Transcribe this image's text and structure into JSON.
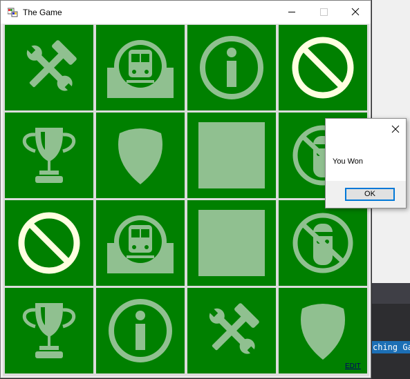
{
  "window": {
    "title": "The Game",
    "buttons": [
      "minimize",
      "maximize",
      "close"
    ]
  },
  "board": {
    "rows": 4,
    "columns": 4,
    "tile_color": "#008000",
    "icon_color": "#90c090",
    "highlight_color": "#ffffe0",
    "tiles": [
      {
        "icon": "tools-icon"
      },
      {
        "icon": "train-icon"
      },
      {
        "icon": "info-icon"
      },
      {
        "icon": "no-entry-icon",
        "highlighted": true
      },
      {
        "icon": "trophy-icon"
      },
      {
        "icon": "shield-icon"
      },
      {
        "icon": "square-icon"
      },
      {
        "icon": "no-smoking-man-icon"
      },
      {
        "icon": "no-entry-icon",
        "highlighted": true
      },
      {
        "icon": "train-icon"
      },
      {
        "icon": "square-icon"
      },
      {
        "icon": "no-smoking-man-icon"
      },
      {
        "icon": "trophy-icon"
      },
      {
        "icon": "info-icon"
      },
      {
        "icon": "tools-icon"
      },
      {
        "icon": "shield-icon"
      }
    ]
  },
  "edit_link": "EDIT",
  "message_box": {
    "text": "You Won",
    "ok_label": "OK"
  },
  "background_ide": {
    "tab_text": "ching Ga"
  }
}
